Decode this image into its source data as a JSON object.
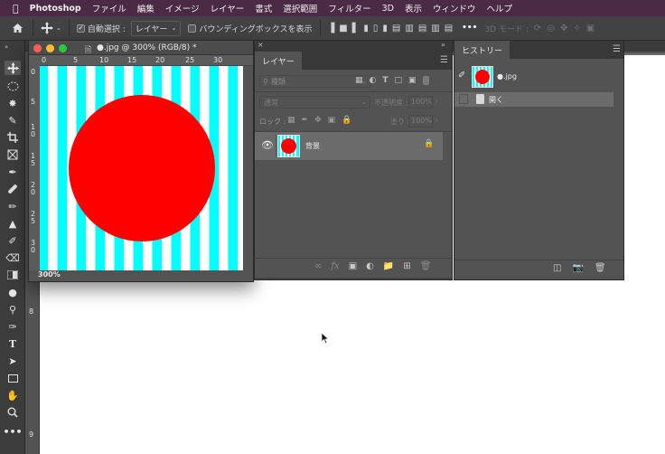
{
  "menubar": {
    "apple": "",
    "items": [
      "Photoshop",
      "ファイル",
      "編集",
      "イメージ",
      "レイヤー",
      "書式",
      "選択範囲",
      "フィルター",
      "3D",
      "表示",
      "ウィンドウ",
      "ヘルプ"
    ]
  },
  "options_bar": {
    "home_icon": "home-icon",
    "move_icon": "move-icon",
    "auto_select_label": "自動選択 :",
    "auto_select_checked": true,
    "layer_select_value": "レイヤー",
    "bounding_box_label": "バウンディングボックスを表示",
    "mode_3d_label": "3D モード :",
    "more_label": "•••"
  },
  "document": {
    "title": "●.jpg @ 300% (RGB/8) *",
    "zoom_status": "300%",
    "ruler_h": [
      "0",
      "5",
      "10",
      "15",
      "20",
      "25",
      "30"
    ],
    "ruler_v": [
      "0",
      "5",
      "1 0",
      "1 5",
      "2 0",
      "2 5",
      "3 0"
    ],
    "background_color": "#00ffff",
    "stripe_color": "#ffffff",
    "circle_color": "#ff0000"
  },
  "left_ruler": {
    "marks": [
      "8",
      "9"
    ]
  },
  "layers_panel": {
    "tab": "レイヤー",
    "search_placeholder": "種類",
    "blend_mode": "通常",
    "opacity_label": "不透明度 :",
    "opacity_value": "100%",
    "lock_label": "ロック :",
    "fill_label": "塗り :",
    "fill_value": "100%",
    "layers": [
      {
        "name": "背景",
        "visible": true,
        "locked": true
      }
    ],
    "footer_icons": [
      "link-icon",
      "fx-icon",
      "mask-icon",
      "adjustment-icon",
      "folder-icon",
      "new-layer-icon",
      "trash-icon"
    ]
  },
  "history_panel": {
    "tab": "ヒストリー",
    "snapshot_name": "●.jpg",
    "states": [
      "開く"
    ],
    "footer_icons": [
      "new-document-from-state-icon",
      "camera-icon",
      "trash-icon"
    ]
  },
  "tools": [
    "move-icon",
    "marquee-icon",
    "lasso-icon",
    "quick-select-icon",
    "crop-icon",
    "frame-icon",
    "eyedropper-icon",
    "healing-icon",
    "brush-icon",
    "stamp-icon",
    "history-brush-icon",
    "eraser-icon",
    "gradient-icon",
    "blur-icon",
    "dodge-icon",
    "pen-icon",
    "type-icon",
    "path-select-icon",
    "rectangle-icon",
    "hand-icon",
    "zoom-icon",
    "more-tools-icon"
  ]
}
